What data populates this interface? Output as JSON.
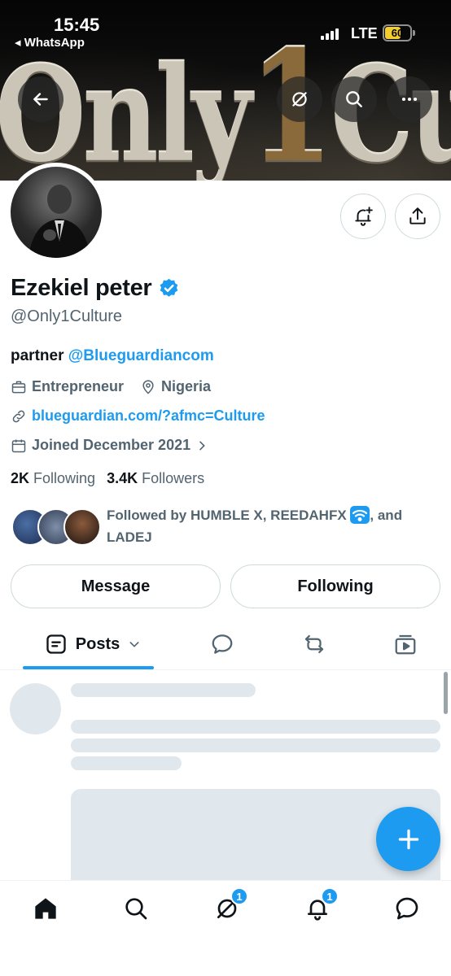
{
  "status_bar": {
    "time": "15:45",
    "back_app": "◂ WhatsApp",
    "network": "LTE",
    "battery": "60"
  },
  "banner": {
    "text_part1": "Only",
    "text_part2": "1",
    "text_part3": "Culture"
  },
  "profile": {
    "name": "Ezekiel peter",
    "handle": "@Only1Culture",
    "bio_prefix": "partner ",
    "bio_mention": "@Blueguardiancom",
    "profession": "Entrepreneur",
    "location": "Nigeria",
    "website": "blueguardian.com/?afmc=Culture",
    "joined": "Joined December 2021",
    "following_count": "2K",
    "following_label": "Following",
    "followers_count": "3.4K",
    "followers_label": "Followers",
    "followed_by_prefix": "Followed by HUMBLE X, REEDAHFX ",
    "followed_by_suffix": ", and LADEJ"
  },
  "actions": {
    "message": "Message",
    "following": "Following"
  },
  "tabs": {
    "posts": "Posts"
  },
  "bottom_nav": {
    "grok_badge": "1",
    "notifications_badge": "1"
  },
  "colors": {
    "accent": "#1d9bf0",
    "text_primary": "#0f1419",
    "text_secondary": "#536471",
    "skeleton": "#e1e8ed"
  }
}
